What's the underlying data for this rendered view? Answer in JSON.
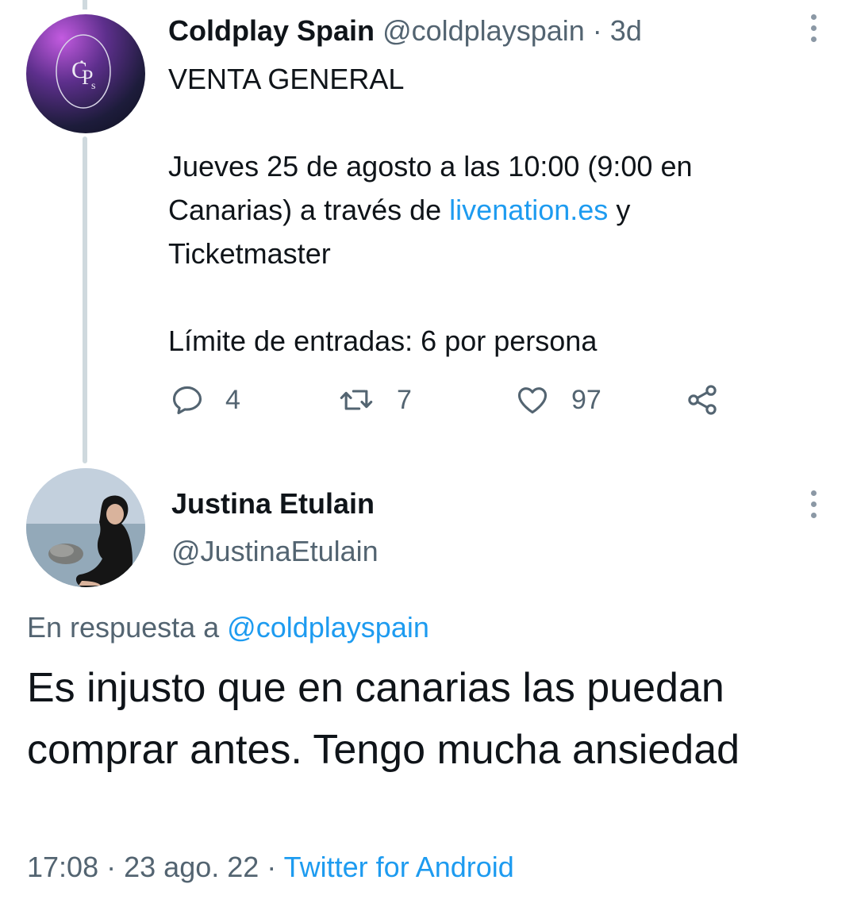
{
  "original_tweet": {
    "display_name": "Coldplay Spain",
    "handle": "@coldplayspain",
    "separator": "·",
    "age": "3d",
    "avatar_monogram": "CPs",
    "lines": {
      "heading": "VENTA GENERAL",
      "date_line_1": "Jueves 25 de agosto a las 10:00 (9:00 en",
      "date_line_2_prefix": "Canarias) a través de ",
      "date_line_2_link": "livenation.es",
      "date_line_2_suffix": " y",
      "date_line_3": "Ticketmaster",
      "limit_line": "Límite de entradas: 6 por persona"
    },
    "stats": {
      "replies": "4",
      "retweets": "7",
      "likes": "97"
    }
  },
  "reply_tweet": {
    "display_name": "Justina Etulain",
    "handle": "@JustinaEtulain",
    "in_reply_prefix": "En respuesta a ",
    "in_reply_handle": "@coldplayspain",
    "text": "Es injusto que en canarias las puedan comprar antes. Tengo mucha ansiedad",
    "time": "17:08",
    "separator": "·",
    "date": "23 ago. 22",
    "source": "Twitter for Android"
  },
  "colors": {
    "text_primary": "#0f1419",
    "text_secondary": "#536471",
    "link": "#1d9bf0",
    "thread_line": "#cfd9de"
  },
  "icons": {
    "reply": "reply-icon",
    "retweet": "retweet-icon",
    "like": "heart-icon",
    "share": "share-icon",
    "more": "more-vertical-icon"
  }
}
